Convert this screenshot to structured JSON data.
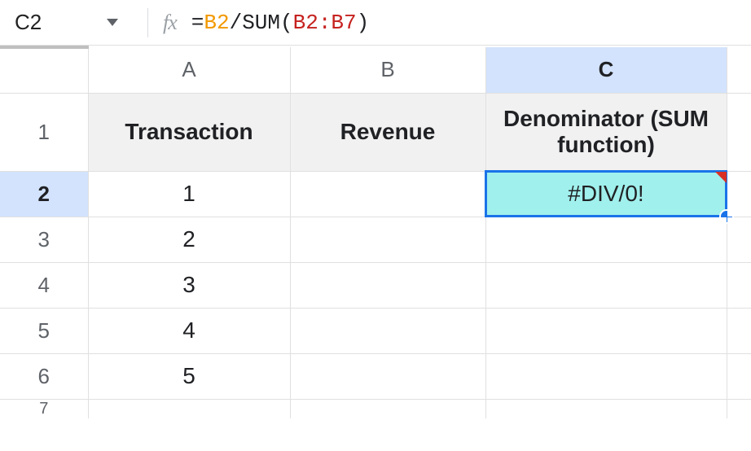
{
  "name_box": {
    "cell_ref": "C2"
  },
  "formula": {
    "eq": "=",
    "ref1": "B2",
    "op": "/",
    "func": "SUM",
    "lpar": "(",
    "range": "B2:B7",
    "rpar": ")"
  },
  "columns": {
    "a": "A",
    "b": "B",
    "c": "C"
  },
  "rows": {
    "r1": "1",
    "r2": "2",
    "r3": "3",
    "r4": "4",
    "r5": "5",
    "r6": "6",
    "r7": "7"
  },
  "headers": {
    "a": "Transaction",
    "b": "Revenue",
    "c": "Denominator (SUM function)"
  },
  "cells": {
    "a2": "1",
    "a3": "2",
    "a4": "3",
    "a5": "4",
    "a6": "5",
    "c2": "#DIV/0!"
  },
  "fx_label": "fx"
}
